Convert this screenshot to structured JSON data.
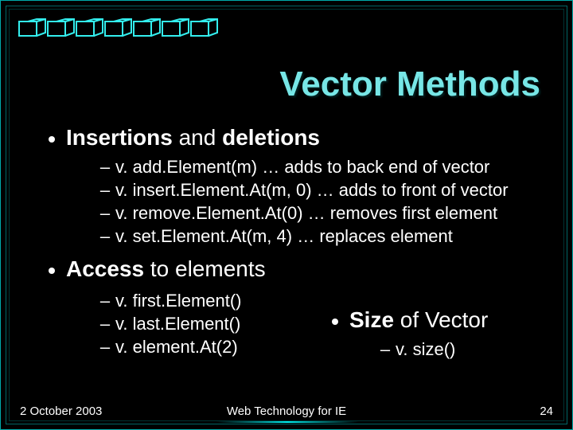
{
  "title": "Vector Methods",
  "section1": {
    "heading_bold": "Insertions",
    "heading_rest": " and ",
    "heading_bold2": "deletions",
    "items": [
      "v. add.Element(m) … adds to back end of vector",
      "v. insert.Element.At(m, 0) … adds to front of vector",
      "v. remove.Element.At(0) … removes first element",
      "v. set.Element.At(m, 4) … replaces element"
    ]
  },
  "section2": {
    "heading_bold": "Access",
    "heading_rest": " to elements",
    "items": [
      "v. first.Element()",
      "v. last.Element()",
      "v. element.At(2)"
    ]
  },
  "section3": {
    "heading_bold": "Size",
    "heading_rest": " of Vector",
    "items": [
      "v. size()"
    ]
  },
  "footer": {
    "date": "2 October 2003",
    "center": "Web Technology for IE",
    "page": "24"
  }
}
